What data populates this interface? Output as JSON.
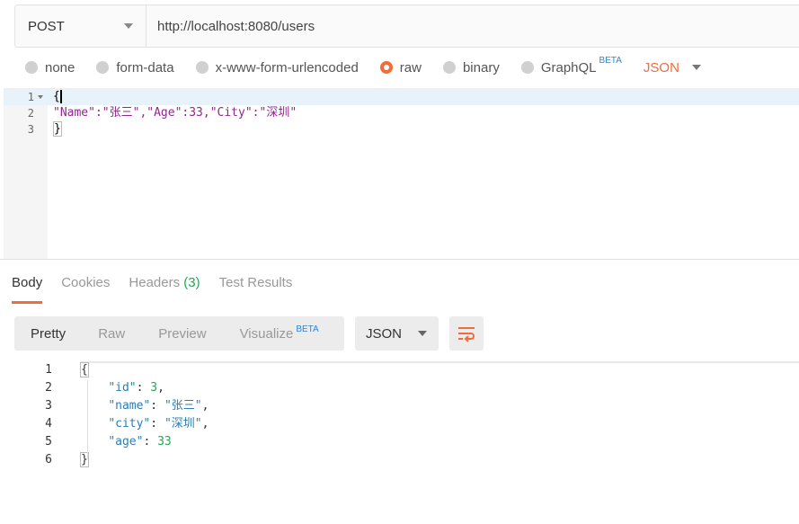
{
  "request": {
    "method": "POST",
    "url": "http://localhost:8080/users"
  },
  "body_types": {
    "options": [
      {
        "label": "none",
        "selected": false
      },
      {
        "label": "form-data",
        "selected": false
      },
      {
        "label": "x-www-form-urlencoded",
        "selected": false
      },
      {
        "label": "raw",
        "selected": true
      },
      {
        "label": "binary",
        "selected": false
      },
      {
        "label": "GraphQL",
        "selected": false
      }
    ],
    "graphql_badge": "BETA",
    "format": "JSON"
  },
  "request_body": {
    "lines": [
      {
        "num": "1",
        "text": "{"
      },
      {
        "num": "2",
        "text": "\"Name\":\"张三\",\"Age\":33,\"City\":\"深圳\""
      },
      {
        "num": "3",
        "text": "}"
      }
    ]
  },
  "response_tabs": {
    "body": "Body",
    "cookies": "Cookies",
    "headers": "Headers",
    "headers_count": "(3)",
    "test_results": "Test Results"
  },
  "view_modes": {
    "pretty": "Pretty",
    "raw": "Raw",
    "preview": "Preview",
    "visualize": "Visualize",
    "visualize_badge": "BETA",
    "format": "JSON"
  },
  "response_body": {
    "line_numbers": [
      "1",
      "2",
      "3",
      "4",
      "5",
      "6"
    ],
    "open": "{",
    "close": "}",
    "fields": [
      {
        "key": "\"id\"",
        "value": "3",
        "type": "number",
        "comma": ","
      },
      {
        "key": "\"name\"",
        "value": "\"张三\"",
        "type": "string",
        "comma": ","
      },
      {
        "key": "\"city\"",
        "value": "\"深圳\"",
        "type": "string",
        "comma": ","
      },
      {
        "key": "\"age\"",
        "value": "33",
        "type": "number",
        "comma": ""
      }
    ]
  },
  "colors": {
    "accent": "#f26b3a",
    "count": "#26a65b",
    "beta": "#2f84d8"
  },
  "icons": {
    "wrap": "wrap-lines-icon"
  }
}
